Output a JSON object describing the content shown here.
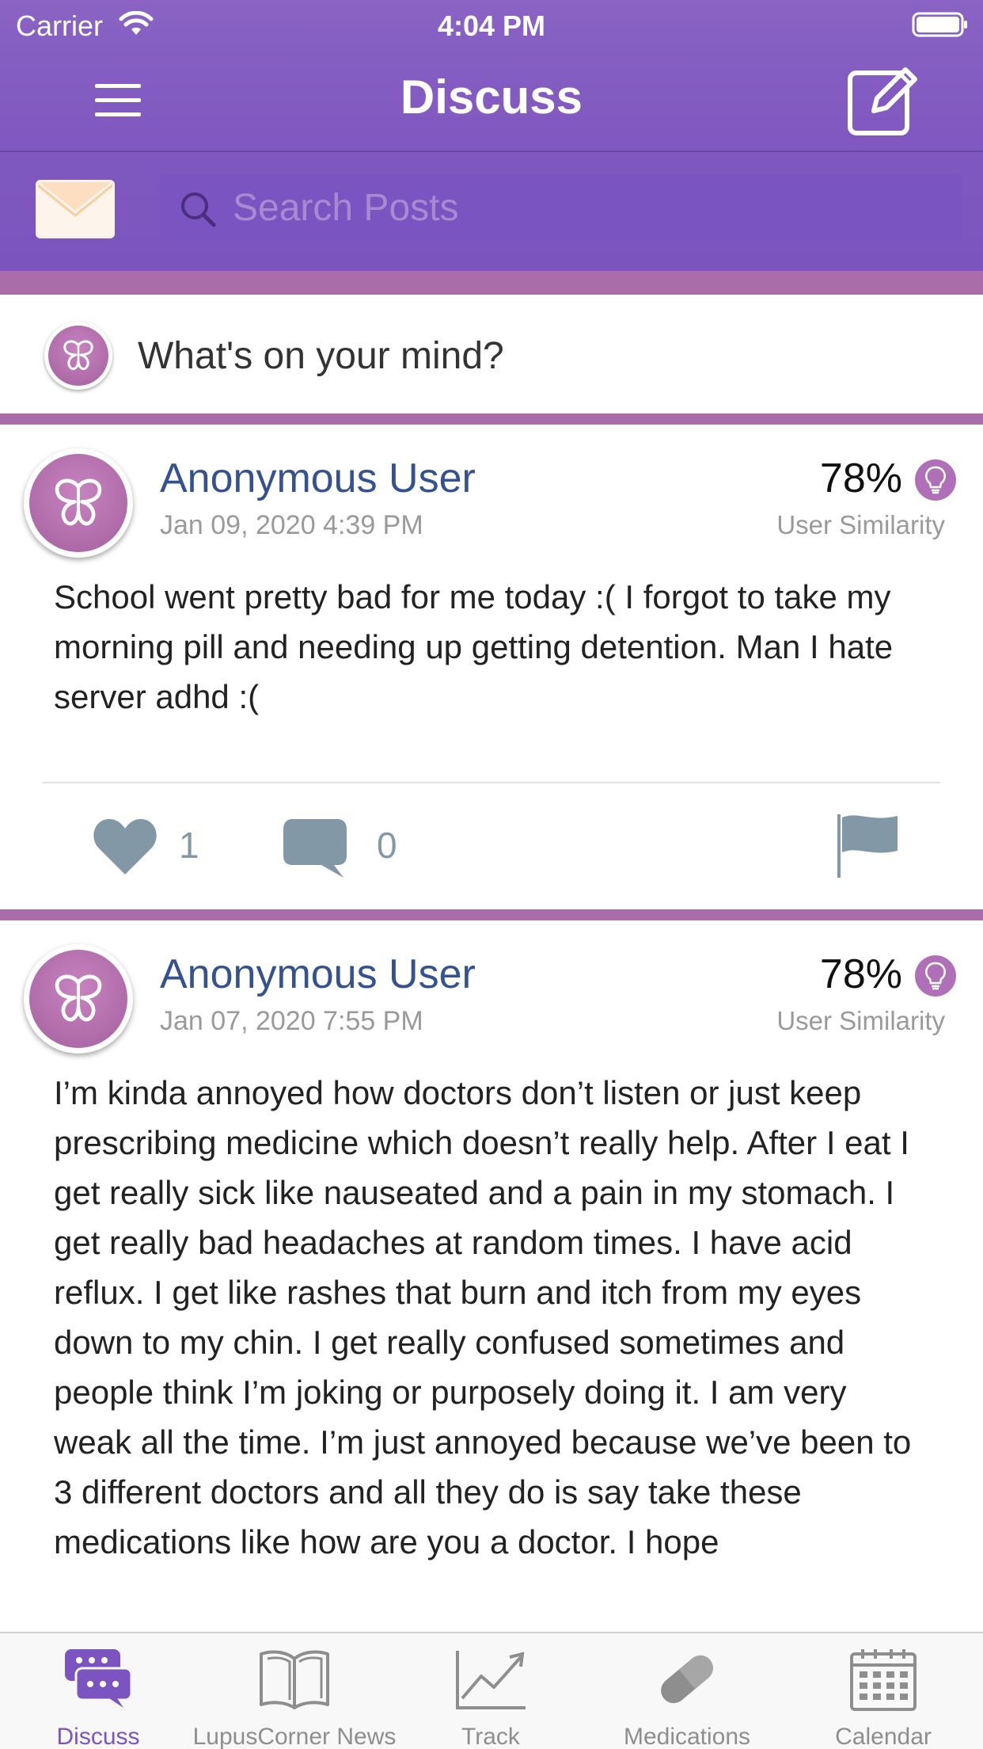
{
  "status_bar": {
    "carrier": "Carrier",
    "time": "4:04 PM"
  },
  "nav": {
    "title": "Discuss"
  },
  "search": {
    "placeholder": "Search Posts"
  },
  "composer": {
    "prompt": "What's on your mind?"
  },
  "posts": [
    {
      "author": "Anonymous User",
      "timestamp": "Jan 09, 2020 4:39 PM",
      "similarity": "78%",
      "similarity_label": "User Similarity",
      "body": "School went pretty bad for me today :( I forgot to take my morning pill and needing up getting detention. Man I hate server adhd :(",
      "likes": "1",
      "comments": "0"
    },
    {
      "author": "Anonymous User",
      "timestamp": "Jan 07, 2020 7:55 PM",
      "similarity": "78%",
      "similarity_label": "User Similarity",
      "body": "I’m kinda annoyed how doctors don’t listen or just keep prescribing medicine which doesn’t really help. After I eat I get really sick like nauseated and a pain in my stomach. I get really bad headaches at random times. I have acid reflux. I get like rashes that burn and itch from my eyes down to my chin. I get really confused sometimes and people think I’m joking or purposely doing it. I am very weak all the time. I’m just annoyed because we’ve been to 3 different doctors and all they do is say take these medications like how are you a doctor. I hope"
    }
  ],
  "tabs": [
    {
      "label": "Discuss",
      "icon": "chat-bubbles-icon",
      "active": true
    },
    {
      "label": "LupusCorner News",
      "icon": "book-icon",
      "active": false
    },
    {
      "label": "Track",
      "icon": "chart-line-icon",
      "active": false
    },
    {
      "label": "Medications",
      "icon": "pill-icon",
      "active": false
    },
    {
      "label": "Calendar",
      "icon": "calendar-icon",
      "active": false
    }
  ],
  "colors": {
    "header_purple": "#8159c0",
    "accent_pink": "#a96da9",
    "author_blue": "#33528f",
    "action_gray": "#8398a6",
    "active_tab": "#7c54c0"
  }
}
